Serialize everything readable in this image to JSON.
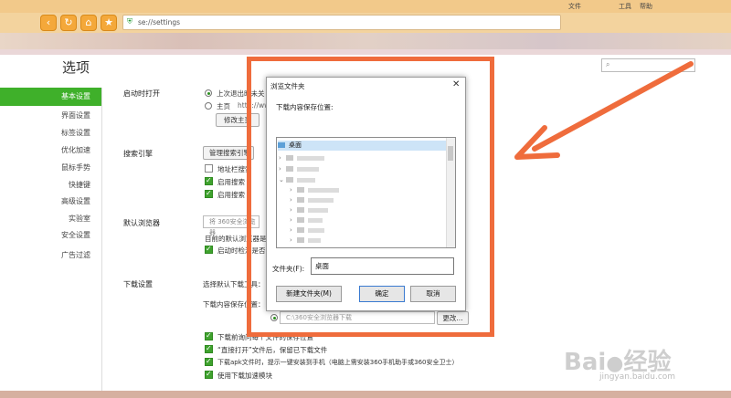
{
  "browser": {
    "top_links": [
      "文件",
      "工具",
      "帮助"
    ],
    "url": "se://settings",
    "nav_icons": [
      "back-icon",
      "refresh-icon",
      "home-icon",
      "star-icon"
    ]
  },
  "settings": {
    "title": "选项",
    "sidebar": [
      {
        "label": "基本设置",
        "active": true
      },
      {
        "label": "界面设置"
      },
      {
        "label": "标签设置"
      },
      {
        "label": "优化加速"
      },
      {
        "label": "鼠标手势"
      },
      {
        "label": "快捷键"
      },
      {
        "label": "高级设置"
      },
      {
        "label": "实验室"
      },
      {
        "label": "安全设置"
      },
      {
        "label": "广告过滤"
      }
    ],
    "startup": {
      "label": "启动时打开",
      "option1": "上次退出时未关",
      "option2": "主页",
      "homepage_partial": "http://ww",
      "modify_button": "修改主页"
    },
    "search": {
      "label": "搜索引擎",
      "manage_button": "管理搜索引擎",
      "opt1": "地址栏搜索",
      "opt2": "启用搜索",
      "opt3": "启用搜索"
    },
    "default_browser": {
      "label": "默认浏览器",
      "field": "将 360安全浏览器",
      "note": "目前的默认浏览器是",
      "check": "启动时检测是否"
    },
    "download": {
      "label": "下载设置",
      "choose_tool": "选择默认下载工具：",
      "save_location_label": "下载内容保存位置：",
      "path": "C:\\360安全浏览器下载",
      "change_button": "更改...",
      "opt1": "下载前询问每个文件的保存位置",
      "opt2": "“直接打开”文件后，保留已下载文件",
      "opt3": "下载apk文件时，提示一键安装到手机（电脑上需安装360手机助手或360安全卫士）",
      "opt4": "使用下载加速模块"
    }
  },
  "dialog": {
    "title": "浏览文件夹",
    "prompt": "下载内容保存位置:",
    "tree_root": "桌面",
    "folder_label": "文件夹(F):",
    "folder_value": "桌面",
    "new_folder_button": "新建文件夹(M)",
    "ok_button": "确定",
    "cancel_button": "取消"
  },
  "watermark": {
    "brand": "Bai",
    "suffix": "经验",
    "url": "jingyan.baidu.com"
  }
}
